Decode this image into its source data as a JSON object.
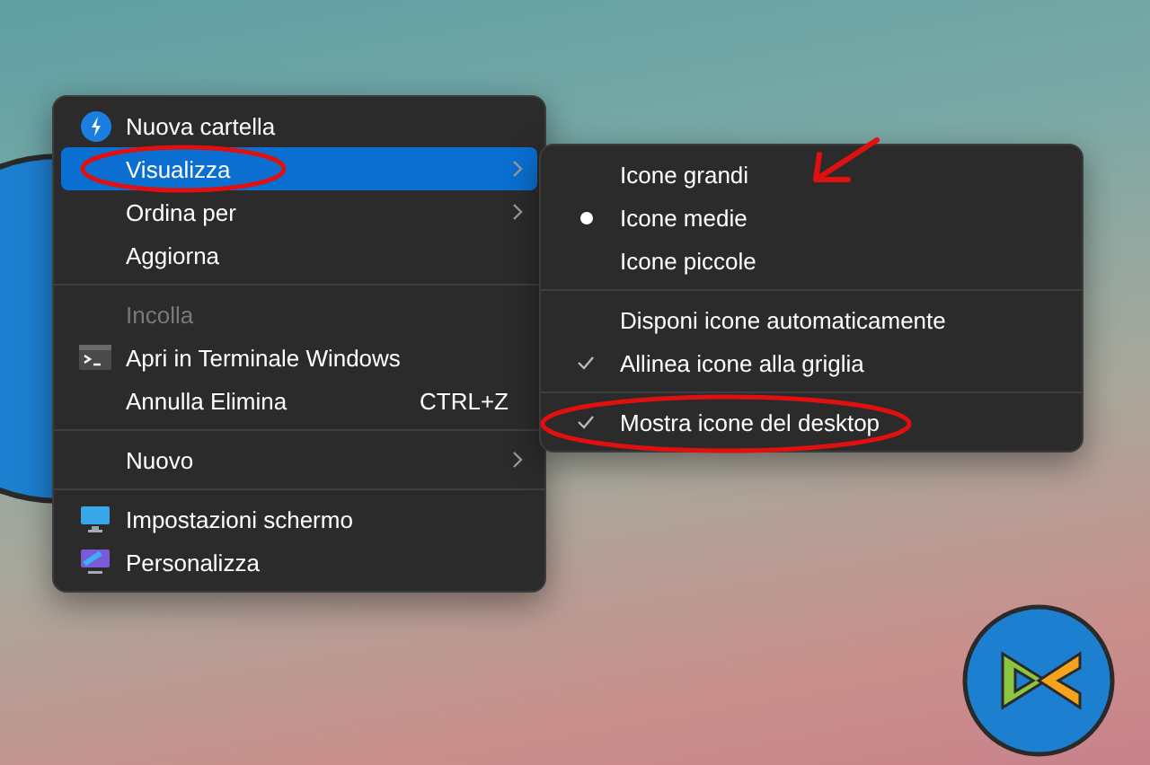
{
  "main_menu": {
    "items": [
      {
        "kind": "item",
        "label": "Nuova cartella",
        "selected": false,
        "disabled": false,
        "submenu": false
      },
      {
        "kind": "item",
        "label": "Visualizza",
        "selected": true,
        "disabled": false,
        "submenu": true
      },
      {
        "kind": "item",
        "label": "Ordina per",
        "selected": false,
        "disabled": false,
        "submenu": true
      },
      {
        "kind": "item",
        "label": "Aggiorna",
        "selected": false,
        "disabled": false,
        "submenu": false
      },
      {
        "kind": "separator"
      },
      {
        "kind": "item",
        "label": "Incolla",
        "selected": false,
        "disabled": true,
        "submenu": false
      },
      {
        "kind": "item",
        "label": "Apri in Terminale Windows",
        "selected": false,
        "disabled": false,
        "submenu": false
      },
      {
        "kind": "item",
        "label": "Annulla Elimina",
        "shortcut": "CTRL+Z",
        "selected": false,
        "disabled": false,
        "submenu": false
      },
      {
        "kind": "separator"
      },
      {
        "kind": "item",
        "label": "Nuovo",
        "selected": false,
        "disabled": false,
        "submenu": true
      },
      {
        "kind": "separator"
      },
      {
        "kind": "item",
        "label": "Impostazioni schermo",
        "selected": false,
        "disabled": false,
        "submenu": false
      },
      {
        "kind": "item",
        "label": "Personalizza",
        "selected": false,
        "disabled": false,
        "submenu": false
      }
    ]
  },
  "view_submenu": {
    "items": [
      {
        "kind": "radio",
        "label": "Icone grandi",
        "checked": false
      },
      {
        "kind": "radio",
        "label": "Icone medie",
        "checked": true
      },
      {
        "kind": "radio",
        "label": "Icone piccole",
        "checked": false
      },
      {
        "kind": "separator"
      },
      {
        "kind": "check",
        "label": "Disponi icone automaticamente",
        "checked": false
      },
      {
        "kind": "check",
        "label": "Allinea icone alla griglia",
        "checked": true
      },
      {
        "kind": "separator"
      },
      {
        "kind": "check",
        "label": "Mostra icone del desktop",
        "checked": true
      }
    ]
  }
}
